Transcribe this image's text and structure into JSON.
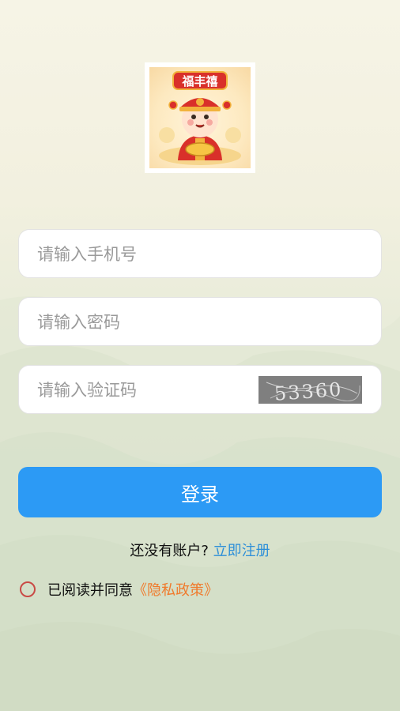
{
  "logo": {
    "banner_text": "福丰禧",
    "icon": "fortune-god-logo-icon"
  },
  "form": {
    "phone_placeholder": "请输入手机号",
    "password_placeholder": "请输入密码",
    "code_placeholder": "请输入验证码",
    "captcha_text": "53360"
  },
  "actions": {
    "login_label": "登录",
    "no_account_text": "还没有账户?",
    "register_label": "立即注册"
  },
  "agreement": {
    "text": "已阅读并同意",
    "policy_label": "《隐私政策》"
  },
  "colors": {
    "accent": "#2c9af5",
    "link": "#2d8fd8",
    "policy": "#f07a2c",
    "radio": "#c94a45"
  }
}
